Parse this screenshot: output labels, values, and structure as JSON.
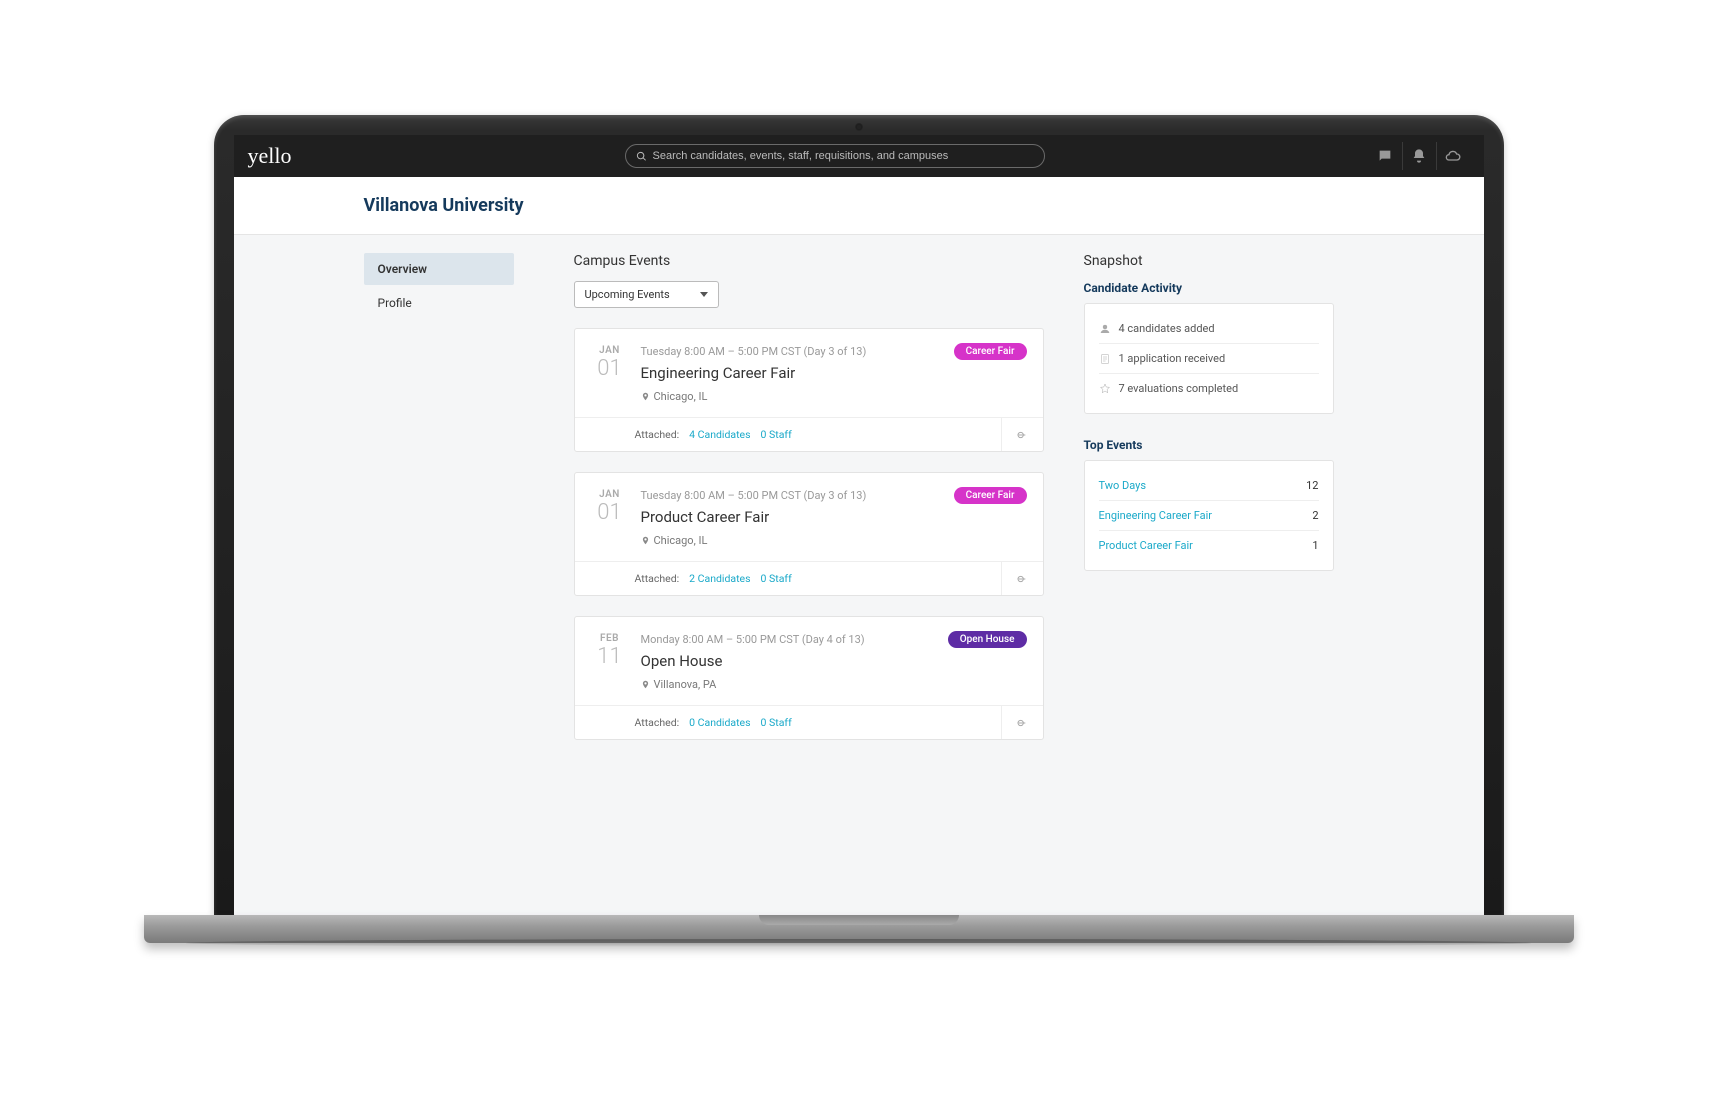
{
  "brand": "yello",
  "search": {
    "placeholder": "Search candidates, events, staff, requisitions, and campuses"
  },
  "page_title": "Villanova University",
  "sidebar": {
    "items": [
      {
        "label": "Overview",
        "active": true
      },
      {
        "label": "Profile",
        "active": false
      }
    ]
  },
  "events_section": {
    "title": "Campus Events",
    "filter_label": "Upcoming Events",
    "attached_label": "Attached:"
  },
  "events": [
    {
      "month": "JAN",
      "day": "01",
      "time": "Tuesday 8:00 AM – 5:00 PM CST (Day 3 of 13)",
      "title": "Engineering Career Fair",
      "location": "Chicago, IL",
      "tag": "Career Fair",
      "tag_style": "magenta",
      "candidates_link": "4 Candidates",
      "staff_link": "0 Staff"
    },
    {
      "month": "JAN",
      "day": "01",
      "time": "Tuesday 8:00 AM – 5:00 PM CST (Day 3 of 13)",
      "title": "Product Career Fair",
      "location": "Chicago, IL",
      "tag": "Career Fair",
      "tag_style": "magenta",
      "candidates_link": "2 Candidates",
      "staff_link": "0 Staff"
    },
    {
      "month": "FEB",
      "day": "11",
      "time": "Monday 8:00 AM – 5:00 PM CST (Day 4 of 13)",
      "title": "Open House",
      "location": "Villanova, PA",
      "tag": "Open House",
      "tag_style": "purple",
      "candidates_link": "0 Candidates",
      "staff_link": "0 Staff"
    }
  ],
  "snapshot": {
    "title": "Snapshot",
    "activity_title": "Candidate Activity",
    "activity": [
      {
        "text": "4 candidates added"
      },
      {
        "text": "1 application received"
      },
      {
        "text": "7 evaluations completed"
      }
    ],
    "top_events_title": "Top Events",
    "top_events": [
      {
        "name": "Two Days",
        "count": "12"
      },
      {
        "name": "Engineering Career Fair",
        "count": "2"
      },
      {
        "name": "Product Career Fair",
        "count": "1"
      }
    ]
  }
}
